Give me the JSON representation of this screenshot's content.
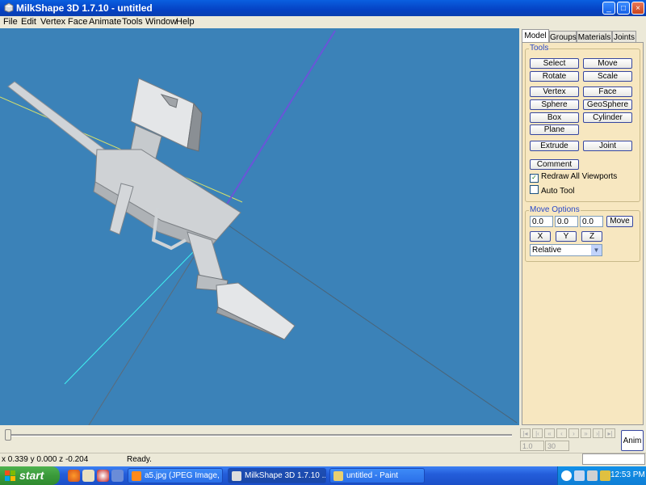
{
  "window": {
    "title": "MilkShape 3D 1.7.10 - untitled",
    "min": "_",
    "max": "□",
    "close": "×"
  },
  "menu": [
    "File",
    "Edit",
    "Vertex",
    "Face",
    "Animate",
    "Tools",
    "Window",
    "Help"
  ],
  "tabs": [
    "Model",
    "Groups",
    "Materials",
    "Joints"
  ],
  "tools": {
    "label": "Tools",
    "select": "Select",
    "move": "Move",
    "rotate": "Rotate",
    "scale": "Scale",
    "vertex": "Vertex",
    "face": "Face",
    "sphere": "Sphere",
    "geosphere": "GeoSphere",
    "box": "Box",
    "cylinder": "Cylinder",
    "plane": "Plane",
    "extrude": "Extrude",
    "joint": "Joint",
    "comment": "Comment",
    "redraw": "Redraw All Viewports",
    "redraw_checked": true,
    "auto_tool": "Auto Tool",
    "auto_tool_checked": false
  },
  "move_options": {
    "label": "Move Options",
    "x": "0.0",
    "y": "0.0",
    "z": "0.0",
    "move": "Move",
    "axis_x": "X",
    "axis_y": "Y",
    "axis_z": "Z",
    "mode": "Relative"
  },
  "timeline": {
    "frame_start": "1.0",
    "frame_end": "30",
    "anim": "Anim",
    "progress": 0
  },
  "status": {
    "coords": "x 0.339 y 0.000 z -0.204",
    "message": "Ready."
  },
  "taskbar": {
    "start": "start",
    "tasks": [
      "a5.jpg (JPEG Image, ...",
      "MilkShape 3D 1.7.10 ...",
      "untitled - Paint"
    ],
    "clock": "12:53 PM"
  },
  "colors": {
    "viewport": "#3b82b8",
    "title": "#0542c4",
    "panel": "#f7e7c0",
    "taskbar": "#245edb"
  }
}
